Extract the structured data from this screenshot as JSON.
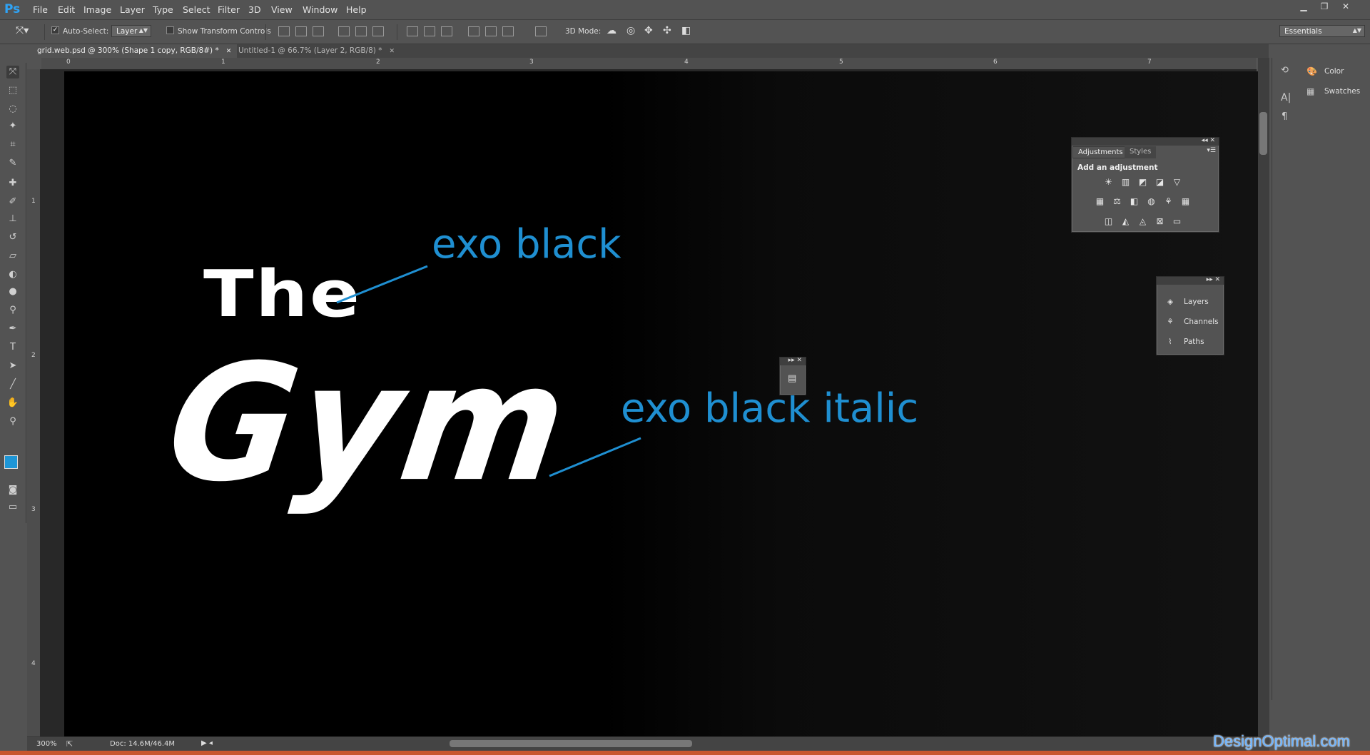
{
  "app": {
    "logo": "Ps"
  },
  "menu": [
    "File",
    "Edit",
    "Image",
    "Layer",
    "Type",
    "Select",
    "Filter",
    "3D",
    "View",
    "Window",
    "Help"
  ],
  "window_controls": {
    "minimize": "▁",
    "restore": "❐",
    "close": "✕"
  },
  "options": {
    "auto_select_label": "Auto-Select:",
    "auto_select_checked": "✓",
    "auto_select_value": "Layer",
    "show_transform_label": "Show Transform Controls",
    "mode_3d_label": "3D Mode:",
    "workspace": "Essentials"
  },
  "tabs": [
    {
      "label": "grid.web.psd @ 300% (Shape 1 copy, RGB/8#) *",
      "close": "✕"
    },
    {
      "label": "Untitled-1 @ 66.7% (Layer 2, RGB/8) *",
      "close": "✕"
    }
  ],
  "ruler_top": [
    "0",
    "1",
    "2",
    "3",
    "4",
    "5",
    "6",
    "7"
  ],
  "ruler_left": [
    "1",
    "2",
    "3",
    "4"
  ],
  "canvas": {
    "the": "The",
    "gym": "Gym",
    "label_black": "exo black",
    "label_black_italic": "exo black italic",
    "accent": "#1f8fd1"
  },
  "status": {
    "zoom": "300%",
    "doc": "Doc: 14.6M/46.4M"
  },
  "dock": {
    "color": "Color",
    "swatches": "Swatches"
  },
  "adjustments": {
    "tab1": "Adjustments",
    "tab2": "Styles",
    "title": "Add an adjustment"
  },
  "layers_panel": {
    "layers": "Layers",
    "channels": "Channels",
    "paths": "Paths"
  },
  "watermark": "DesignOptimal.com"
}
